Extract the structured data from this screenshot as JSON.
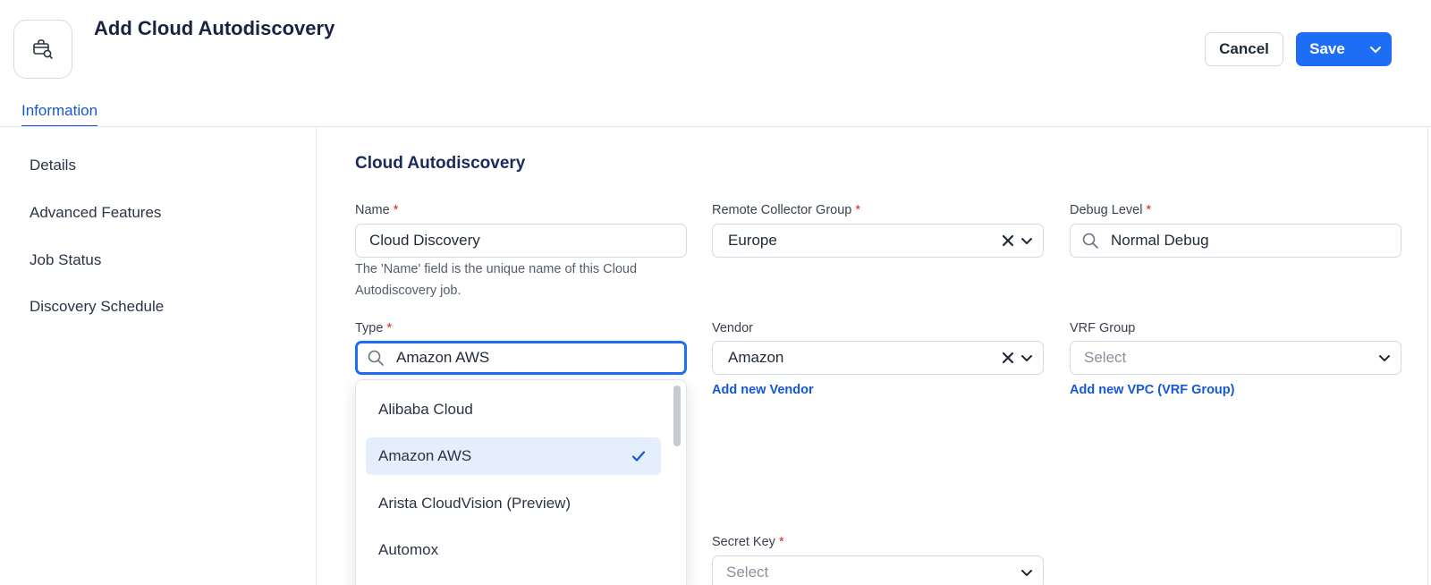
{
  "header": {
    "title": "Add Cloud Autodiscovery",
    "icon": "cloud-search-icon",
    "cancel_label": "Cancel",
    "save_label": "Save"
  },
  "tabs": [
    {
      "label": "Information",
      "active": true
    }
  ],
  "sidebar": {
    "items": [
      {
        "label": "Details"
      },
      {
        "label": "Advanced Features"
      },
      {
        "label": "Job Status"
      },
      {
        "label": "Discovery Schedule"
      }
    ]
  },
  "form": {
    "section_title": "Cloud Autodiscovery",
    "name": {
      "label": "Name",
      "required": "*",
      "value": "Cloud Discovery",
      "help": "The 'Name' field is the unique name of this Cloud Autodiscovery job."
    },
    "remote_collector_group": {
      "label": "Remote Collector Group",
      "required": "*",
      "value": "Europe"
    },
    "debug_level": {
      "label": "Debug Level",
      "required": "*",
      "value": "Normal Debug"
    },
    "type": {
      "label": "Type",
      "required": "*",
      "value": "Amazon AWS",
      "options": [
        {
          "label": "Alibaba Cloud",
          "selected": false
        },
        {
          "label": "Amazon AWS",
          "selected": true
        },
        {
          "label": "Arista CloudVision (Preview)",
          "selected": false
        },
        {
          "label": "Automox",
          "selected": false
        }
      ]
    },
    "vendor": {
      "label": "Vendor",
      "value": "Amazon",
      "add_link": "Add new Vendor"
    },
    "vrf_group": {
      "label": "VRF Group",
      "placeholder": "Select",
      "add_link": "Add new VPC (VRF Group)"
    },
    "secret_key": {
      "label": "Secret Key",
      "required": "*",
      "placeholder": "Select"
    }
  },
  "colors": {
    "accent": "#1e6ef5",
    "link": "#1558d6",
    "required": "#d62424",
    "selected_bg": "#e4eefc",
    "title": "#1a2340"
  }
}
